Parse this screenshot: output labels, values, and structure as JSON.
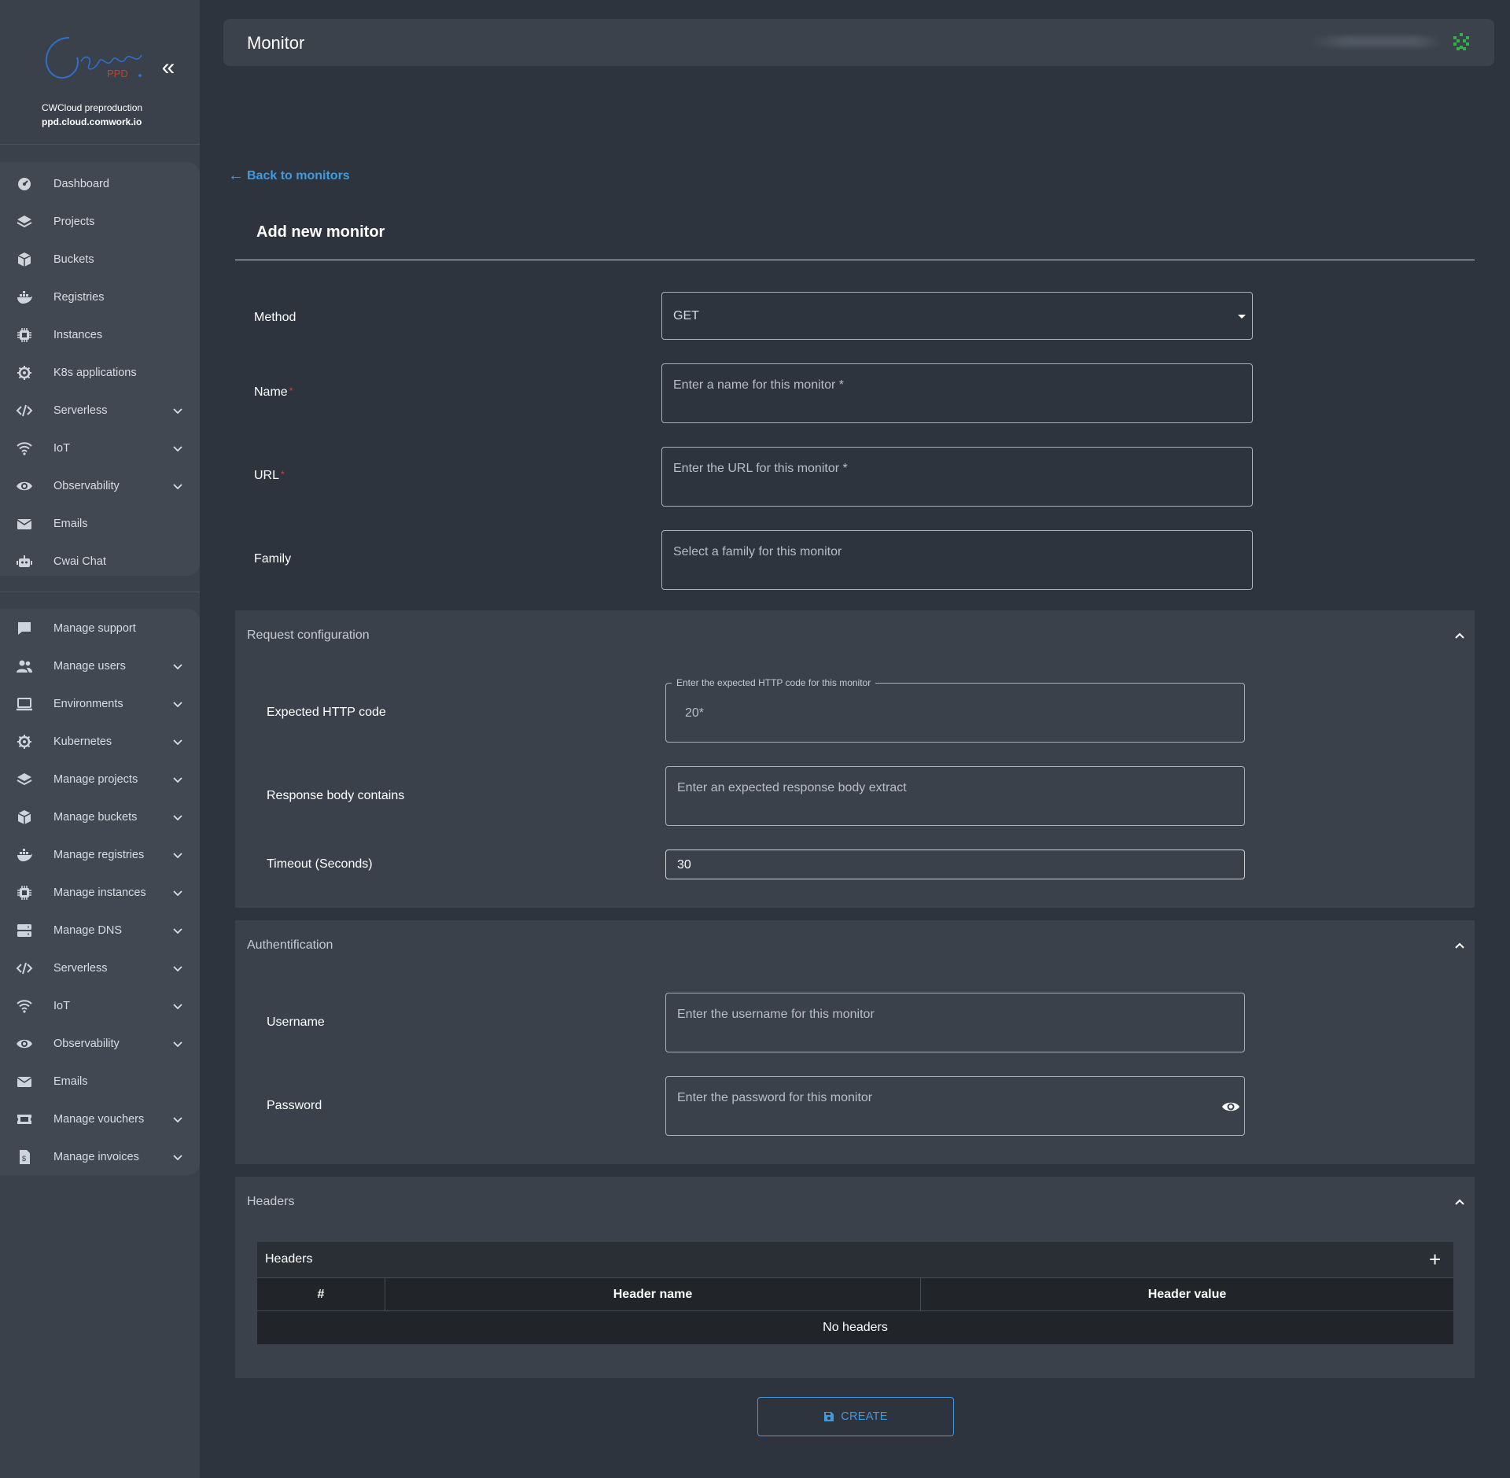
{
  "brand": {
    "env_name": "CWCloud preproduction",
    "env_host": "ppd.cloud.comwork.io",
    "logo_text": "Comwork",
    "logo_sub": "PPD"
  },
  "sidebar": {
    "group1": [
      {
        "label": "Dashboard",
        "icon": "dashboard-icon",
        "expandable": false
      },
      {
        "label": "Projects",
        "icon": "layers-icon",
        "expandable": false
      },
      {
        "label": "Buckets",
        "icon": "box-icon",
        "expandable": false
      },
      {
        "label": "Registries",
        "icon": "docker-icon",
        "expandable": false
      },
      {
        "label": "Instances",
        "icon": "chip-icon",
        "expandable": false
      },
      {
        "label": "K8s applications",
        "icon": "helm-icon",
        "expandable": false
      },
      {
        "label": "Serverless",
        "icon": "code-icon",
        "expandable": true
      },
      {
        "label": "IoT",
        "icon": "wifi-icon",
        "expandable": true
      },
      {
        "label": "Observability",
        "icon": "eye-icon",
        "expandable": true
      },
      {
        "label": "Emails",
        "icon": "envelope-icon",
        "expandable": false
      },
      {
        "label": "Cwai Chat",
        "icon": "robot-icon",
        "expandable": false
      }
    ],
    "group2": [
      {
        "label": "Manage support",
        "icon": "chat-icon",
        "expandable": false
      },
      {
        "label": "Manage users",
        "icon": "users-icon",
        "expandable": true
      },
      {
        "label": "Environments",
        "icon": "laptop-icon",
        "expandable": true
      },
      {
        "label": "Kubernetes",
        "icon": "helm-icon",
        "expandable": true
      },
      {
        "label": "Manage projects",
        "icon": "layers-icon",
        "expandable": true
      },
      {
        "label": "Manage buckets",
        "icon": "box-icon",
        "expandable": true
      },
      {
        "label": "Manage registries",
        "icon": "docker-icon",
        "expandable": true
      },
      {
        "label": "Manage instances",
        "icon": "chip-icon",
        "expandable": true
      },
      {
        "label": "Manage DNS",
        "icon": "server-icon",
        "expandable": true
      },
      {
        "label": "Serverless",
        "icon": "code-icon",
        "expandable": true
      },
      {
        "label": "IoT",
        "icon": "wifi-icon",
        "expandable": true
      },
      {
        "label": "Observability",
        "icon": "eye-icon",
        "expandable": true
      },
      {
        "label": "Emails",
        "icon": "envelope-icon",
        "expandable": false
      },
      {
        "label": "Manage vouchers",
        "icon": "ticket-icon",
        "expandable": true
      },
      {
        "label": "Manage invoices",
        "icon": "invoice-icon",
        "expandable": true
      }
    ]
  },
  "header": {
    "title": "Monitor"
  },
  "page": {
    "back_label": "Back to monitors",
    "card_title": "Add new monitor",
    "method": {
      "label": "Method",
      "value": "GET"
    },
    "name": {
      "label": "Name",
      "required_mark": "*",
      "placeholder": "Enter a name for this monitor *"
    },
    "url": {
      "label": "URL",
      "required_mark": "*",
      "placeholder": "Enter the URL for this monitor *"
    },
    "family": {
      "label": "Family",
      "placeholder": "Select a family for this monitor"
    }
  },
  "request_config": {
    "title": "Request configuration",
    "expected_code": {
      "label": "Expected HTTP code",
      "legend": "Enter the expected HTTP code for this monitor",
      "placeholder": "20*"
    },
    "body_contains": {
      "label": "Response body contains",
      "placeholder": "Enter an expected response body extract"
    },
    "timeout": {
      "label": "Timeout (Seconds)",
      "value": "30"
    }
  },
  "auth": {
    "title": "Authentification",
    "username": {
      "label": "Username",
      "placeholder": "Enter the username for this monitor"
    },
    "password": {
      "label": "Password",
      "placeholder": "Enter the password for this monitor"
    }
  },
  "headers": {
    "title": "Headers",
    "table_title": "Headers",
    "columns": [
      "#",
      "Header name",
      "Header value"
    ],
    "empty": "No headers"
  },
  "actions": {
    "create_label": "CREATE"
  },
  "colors": {
    "accent": "#3f9ae0",
    "required": "#e53935",
    "bg": "#2e343d",
    "sidebar": "#3a414b"
  }
}
